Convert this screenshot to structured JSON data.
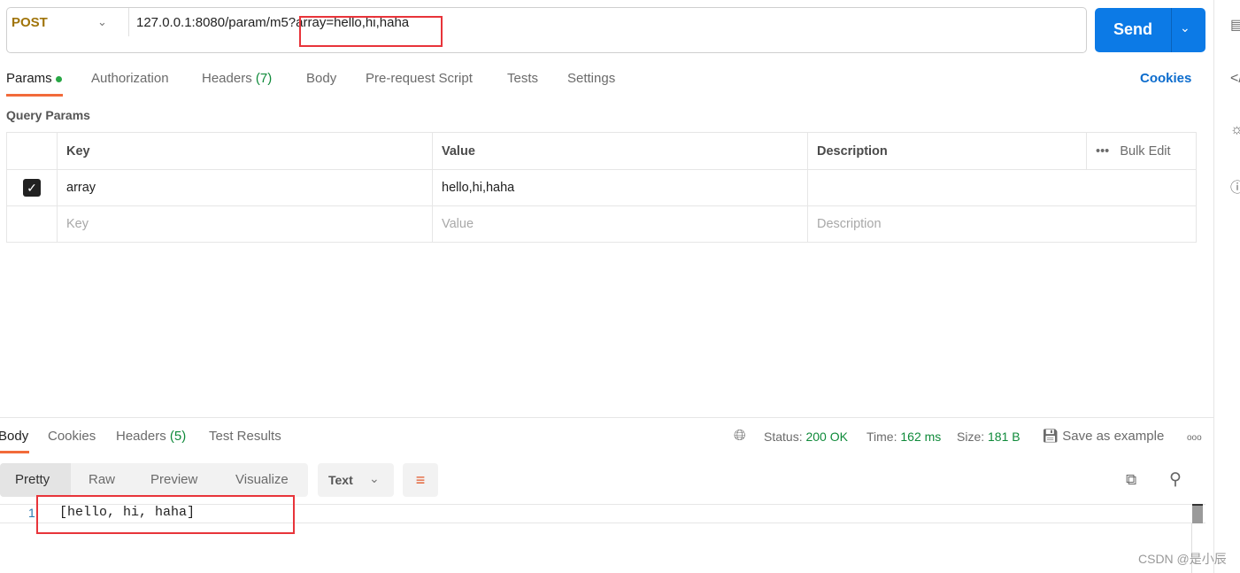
{
  "request": {
    "method": "POST",
    "url_base": "127.0.0.1:8080/param/m5",
    "url_query": "?array=hello,hi,haha",
    "send_label": "Send"
  },
  "tabs": [
    {
      "label": "Params"
    },
    {
      "label": "Authorization"
    },
    {
      "label": "Headers",
      "count": "(7)"
    },
    {
      "label": "Body"
    },
    {
      "label": "Pre-request Script"
    },
    {
      "label": "Tests"
    },
    {
      "label": "Settings"
    }
  ],
  "cookies_link": "Cookies",
  "query_params": {
    "title": "Query Params",
    "headers": [
      "Key",
      "Value",
      "Description"
    ],
    "bulk_edit": "Bulk Edit",
    "rows": [
      {
        "key": "array",
        "value": "hello,hi,haha",
        "description": "",
        "checked": true
      }
    ],
    "placeholders": {
      "key": "Key",
      "value": "Value",
      "description": "Description"
    }
  },
  "response": {
    "tabs": [
      {
        "label": "Body"
      },
      {
        "label": "Cookies"
      },
      {
        "label": "Headers",
        "count": "(5)"
      },
      {
        "label": "Test Results"
      }
    ],
    "status_label": "Status:",
    "status": "200 OK",
    "time_label": "Time:",
    "time": "162 ms",
    "size_label": "Size:",
    "size": "181 B",
    "save_example": "Save as example",
    "views": [
      "Pretty",
      "Raw",
      "Preview",
      "Visualize"
    ],
    "format": "Text",
    "line_number": "1",
    "body": "[hello, hi, haha]"
  },
  "watermark": "CSDN @是小辰",
  "colors": {
    "accent": "#0c7ae6",
    "tab_underline": "#f26b3a",
    "status_green": "#0f8a3a",
    "highlight": "#e8343a"
  }
}
